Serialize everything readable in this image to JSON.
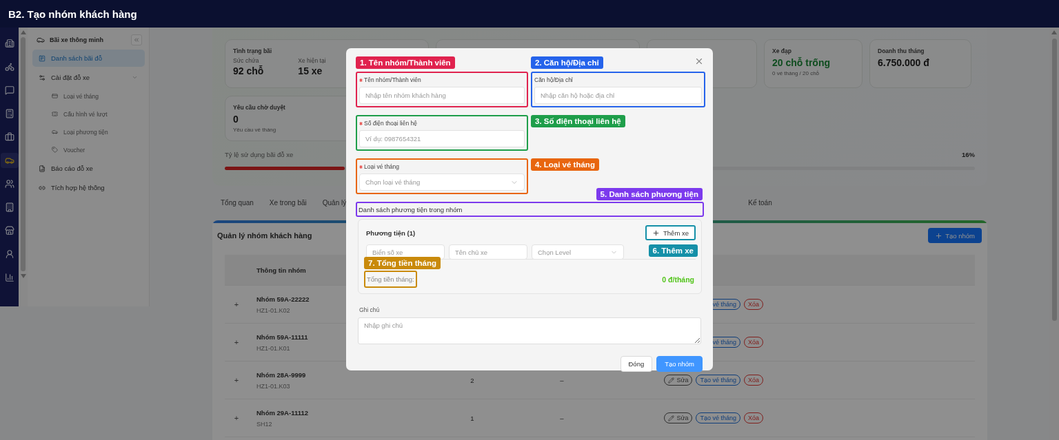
{
  "header": {
    "title": "B2. Tạo nhóm khách hàng"
  },
  "rail": [
    {
      "selected": false
    },
    {
      "selected": false
    },
    {
      "selected": false
    },
    {
      "selected": false
    },
    {
      "selected": false
    },
    {
      "selected": true
    },
    {
      "selected": false
    },
    {
      "selected": false
    },
    {
      "selected": false
    },
    {
      "selected": false
    },
    {
      "selected": false
    }
  ],
  "sidebar": {
    "title": "Bãi xe thông minh",
    "items": [
      {
        "label": "Danh sách bãi đỗ",
        "selected": true
      },
      {
        "label": "Cài đặt đỗ xe",
        "selected": false,
        "expanded": true,
        "children": [
          {
            "label": "Loại vé tháng",
            "selected": false
          },
          {
            "label": "Cấu hình vé lượt",
            "selected": false
          },
          {
            "label": "Loại phương tiện",
            "selected": false
          },
          {
            "label": "Voucher",
            "selected": false
          }
        ]
      },
      {
        "label": "Báo cáo đỗ xe",
        "selected": false
      },
      {
        "label": "Tích hợp hệ thống",
        "selected": false
      }
    ]
  },
  "stats": {
    "cards": [
      {
        "kind": "capacity",
        "title": "Tình trạng bãi",
        "metrics": [
          {
            "label": "Sức chứa",
            "value": "92 chỗ"
          },
          {
            "label": "Xe hiện tại",
            "value": "15 xe"
          }
        ]
      },
      {
        "kind": "blank"
      },
      {
        "kind": "blank"
      },
      {
        "kind": "free",
        "title": "Xe đạp",
        "value": "20 chỗ trống",
        "note": "0 vé tháng / 20 chỗ"
      },
      {
        "kind": "plain",
        "title": "Doanh thu tháng",
        "value": "6.750.000 đ"
      }
    ],
    "pending": {
      "title": "Yêu cầu chờ duyệt",
      "value": "0",
      "note": "Yêu cầu vé tháng"
    },
    "usage": {
      "label": "Tỷ lệ sử dụng bãi đỗ xe",
      "level": 0.16,
      "reading": "16%"
    }
  },
  "tabs": {
    "start": [
      {
        "label": "Tổng quan",
        "selected": false
      },
      {
        "label": "Xe trong bãi",
        "selected": false
      },
      {
        "label": "Quản lý",
        "selected": false
      }
    ],
    "end": [
      {
        "label": "Kế toán",
        "selected": false
      }
    ]
  },
  "groups": {
    "title": "Quản lý nhóm khách hàng",
    "create_button": "Tạo nhóm",
    "columns": [
      "Thông tin nhóm"
    ],
    "rows": [
      {
        "expander": "+",
        "name": "Nhóm 59A-22222",
        "code": "HZ1-01.K02",
        "actions": [
          {
            "kind": "ticket",
            "label": "vé tháng"
          },
          {
            "kind": "delete",
            "label": "Xóa"
          }
        ]
      },
      {
        "expander": "+",
        "name": "Nhóm 59A-11111",
        "code": "HZ1-01.K01",
        "actions": [
          {
            "kind": "ticket",
            "label": "vé tháng"
          },
          {
            "kind": "delete",
            "label": "Xóa"
          }
        ]
      },
      {
        "expander": "+",
        "name": "Nhóm 28A-9999",
        "code": "HZ1-01.K03",
        "count": "2",
        "extra": "–",
        "actions": [
          {
            "kind": "edit",
            "label": "Sửa"
          },
          {
            "kind": "ticket",
            "label": "Tạo vé tháng"
          },
          {
            "kind": "delete",
            "label": "Xóa"
          }
        ]
      },
      {
        "expander": "+",
        "name": "Nhóm 29A-11112",
        "code": "SH12",
        "count": "1",
        "extra": "–",
        "actions": [
          {
            "kind": "edit",
            "label": "Sửa"
          },
          {
            "kind": "ticket",
            "label": "Tạo vé tháng"
          },
          {
            "kind": "delete",
            "label": "Xóa"
          }
        ]
      }
    ]
  },
  "dialog": {
    "fields": [
      {
        "kind": "text",
        "label": "Tên nhóm/Thành viên",
        "required": true,
        "placeholder": "Nhập tên nhóm khách hàng",
        "callout": {
          "text": "1. Tên nhóm/Thành viên",
          "color": "#e0224e"
        }
      },
      {
        "kind": "text",
        "label": "Căn hộ/Địa chỉ",
        "required": false,
        "placeholder": "Nhập căn hộ hoặc địa chỉ",
        "callout": {
          "text": "2. Căn hộ/Địa chỉ",
          "color": "#2563eb"
        }
      },
      {
        "kind": "text",
        "label": "Số điện thoại liên hệ",
        "required": true,
        "placeholder": "Ví dụ: 0987654321",
        "callout": {
          "text": "3. Số điện thoại liên hệ",
          "color": "#1e9e4a"
        }
      },
      {
        "kind": "select",
        "label": "Loại vé tháng",
        "required": true,
        "placeholder": "Chọn loại vé tháng",
        "callout": {
          "text": "4. Loại vé tháng",
          "color": "#e8650f"
        }
      }
    ],
    "vehicles": {
      "title": "Danh sách phương tiện trong nhóm",
      "callout": {
        "text": "5. Danh sách phương tiện",
        "color": "#7c3aed"
      },
      "card_title": "Phương tiện (1)",
      "add_button": {
        "label": "Thêm xe",
        "callout": {
          "text": "6. Thêm xe",
          "color": "#1590a8"
        }
      },
      "inputs": [
        {
          "kind": "text",
          "placeholder": "Biển số xe"
        },
        {
          "kind": "text",
          "placeholder": "Tên chủ xe"
        },
        {
          "kind": "select",
          "placeholder": "Chọn Level"
        }
      ],
      "total": {
        "label": "Tổng tiền tháng:",
        "value": "0 đ/tháng",
        "callout": {
          "text": "7. Tổng tiền tháng",
          "color": "#c98a0b"
        }
      }
    },
    "note": {
      "label": "Ghi chú",
      "placeholder": "Nhập ghi chú"
    },
    "buttons": [
      {
        "kind": "secondary",
        "label": "Đóng"
      },
      {
        "kind": "primary",
        "label": "Tạo nhóm"
      }
    ]
  }
}
